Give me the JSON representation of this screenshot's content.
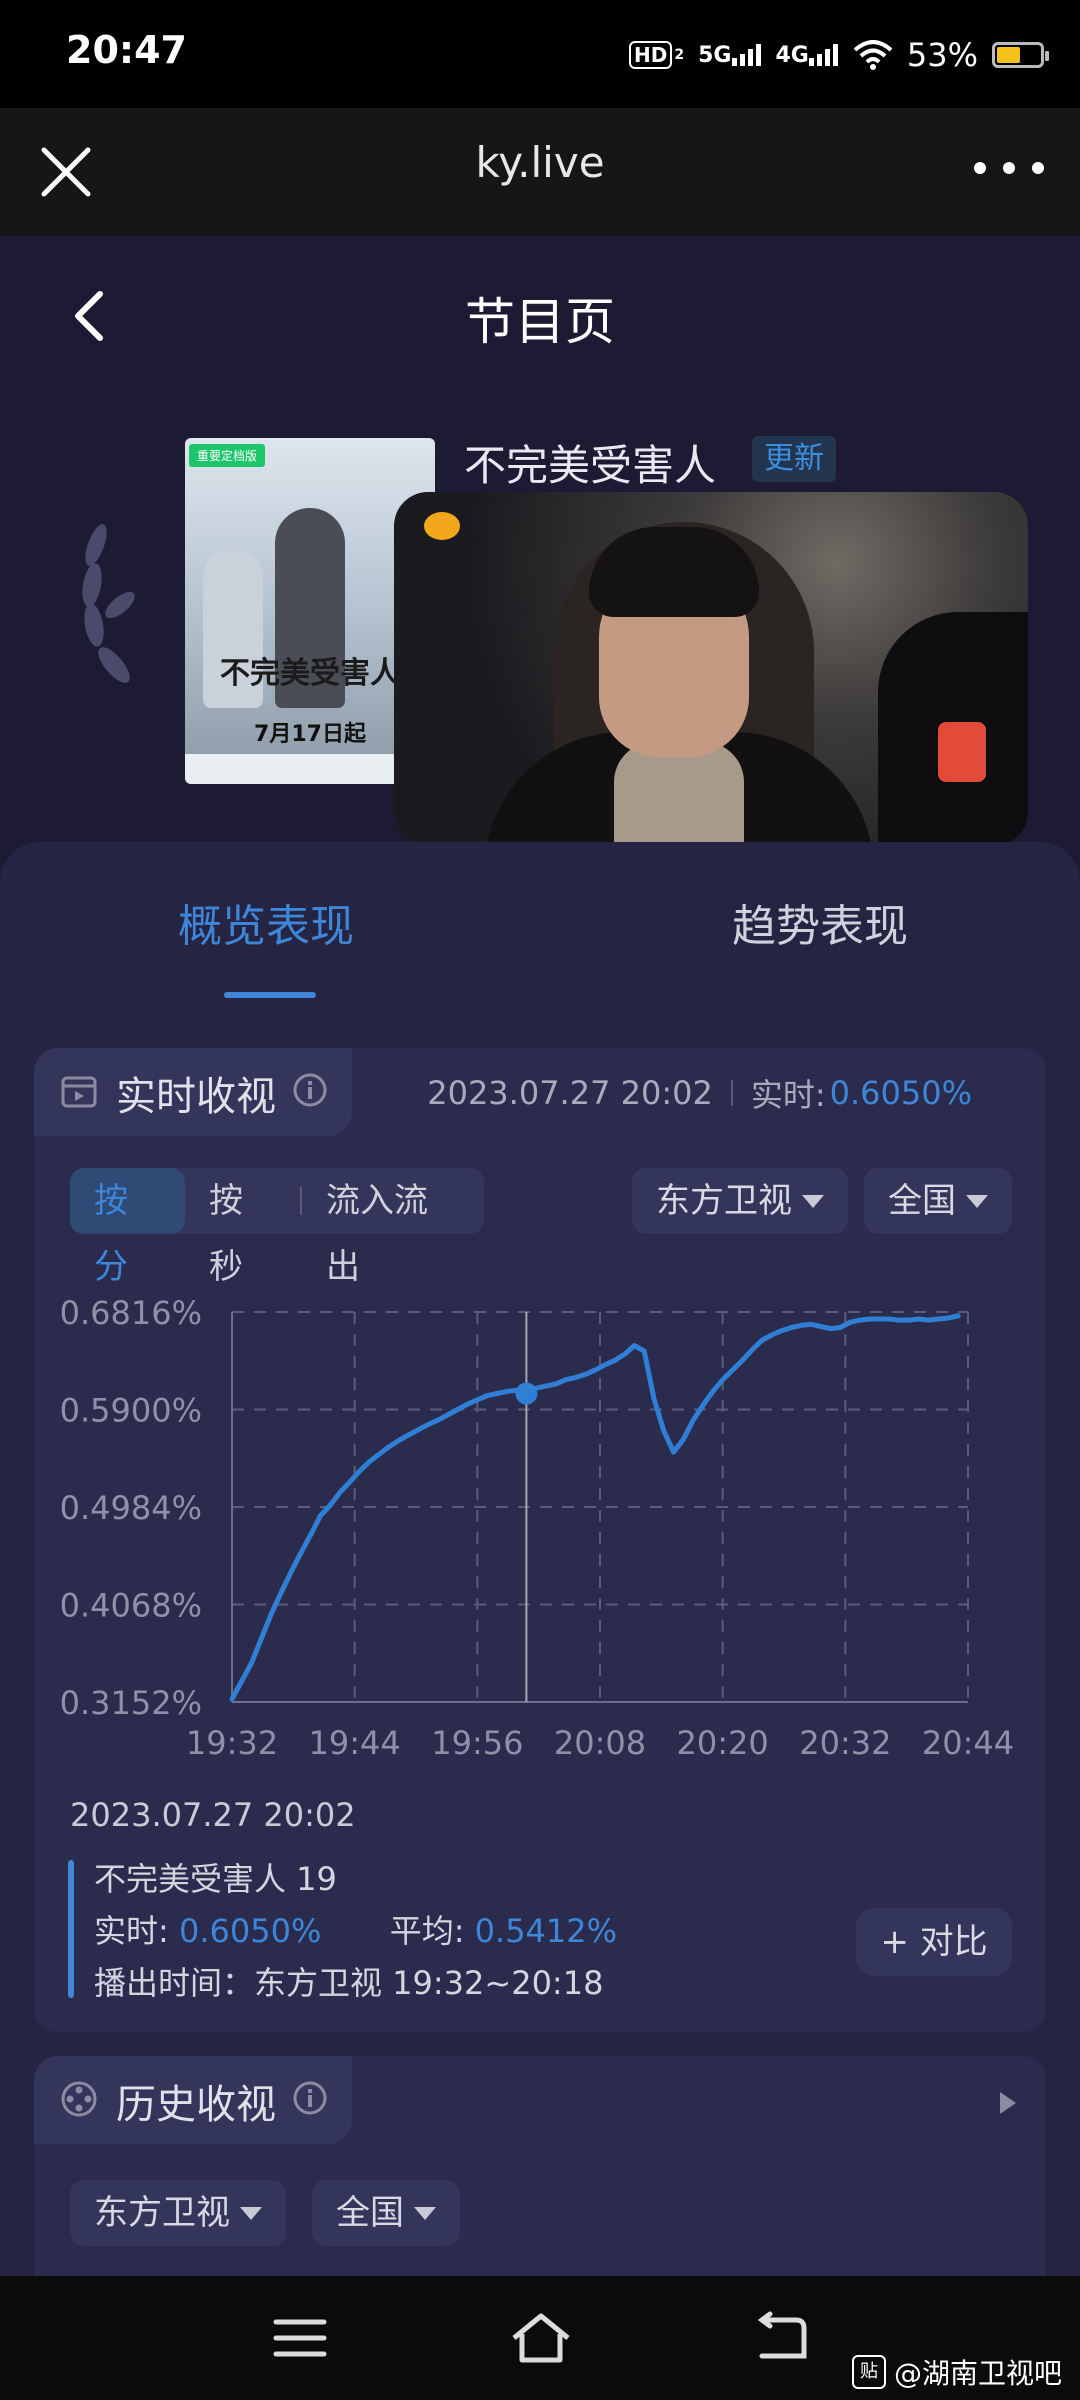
{
  "status_bar": {
    "time": "20:47",
    "hd": "HD",
    "hd_sub": "2",
    "net1": "5G",
    "net2": "4G",
    "battery": "53%",
    "battery_level": 0.53
  },
  "browser": {
    "title": "ky.live"
  },
  "page": {
    "title": "节目页"
  },
  "show": {
    "name": "不完美受害人",
    "tag": "更新",
    "poster": {
      "badge": "重要定档版",
      "title": "不完美受害人",
      "date": "7月17日起"
    }
  },
  "tabs": [
    {
      "label": "概览表现",
      "active": true
    },
    {
      "label": "趋势表现",
      "active": false
    }
  ],
  "realtime": {
    "title": "实时收视",
    "datetime": "2023.07.27 20:02",
    "realtime_label": "实时:",
    "realtime_value": "0.6050%",
    "modes": [
      "按分",
      "按秒",
      "流入流出"
    ],
    "channel": "东方卫视",
    "region": "全国",
    "detail": {
      "datetime": "2023.07.27 20:02",
      "episode": "不完美受害人 19",
      "rt_label": "实时:",
      "rt_value": "0.6050%",
      "avg_label": "平均:",
      "avg_value": "0.5412%",
      "airtime": "播出时间：东方卫视 19:32~20:18"
    },
    "compare_label": "+ 对比"
  },
  "history": {
    "title": "历史收视",
    "channel": "东方卫视",
    "region": "全国"
  },
  "watermark": {
    "icon": "贴",
    "text": "@湖南卫视吧"
  },
  "colors": {
    "accent": "#3d86d8",
    "panel": "#252543",
    "card": "#2b2c4d"
  },
  "chart_data": {
    "type": "line",
    "ylim": [
      0.3152,
      0.6816
    ],
    "yticks": [
      "0.6816%",
      "0.5900%",
      "0.4984%",
      "0.4068%",
      "0.3152%"
    ],
    "xticks": [
      "19:32",
      "19:44",
      "19:56",
      "20:08",
      "20:20",
      "20:32",
      "20:44"
    ],
    "xlim": [
      0,
      75
    ],
    "marker": {
      "x": 30,
      "y": 0.605
    },
    "series": [
      {
        "x": [
          0,
          1,
          2,
          3,
          4,
          5,
          6,
          7,
          8,
          9,
          10,
          11,
          12,
          13,
          14,
          15,
          16,
          17,
          18,
          19,
          20,
          21,
          22,
          23,
          24,
          25,
          26,
          27,
          28,
          29,
          30,
          31,
          32,
          33,
          34,
          35,
          36,
          37,
          38,
          39,
          40,
          41,
          42,
          43,
          44,
          45,
          46,
          47,
          48,
          49,
          50,
          51,
          52,
          53,
          54,
          55,
          56,
          57,
          58,
          59,
          60,
          61,
          62,
          63,
          64,
          65,
          66,
          67,
          68,
          69,
          70,
          71,
          72,
          73,
          74
        ],
        "values": [
          0.318,
          0.335,
          0.352,
          0.375,
          0.398,
          0.418,
          0.437,
          0.455,
          0.472,
          0.49,
          0.5,
          0.512,
          0.522,
          0.532,
          0.541,
          0.548,
          0.555,
          0.561,
          0.566,
          0.571,
          0.576,
          0.58,
          0.585,
          0.59,
          0.595,
          0.599,
          0.603,
          0.605,
          0.607,
          0.608,
          0.605,
          0.61,
          0.612,
          0.614,
          0.618,
          0.62,
          0.623,
          0.627,
          0.632,
          0.636,
          0.642,
          0.65,
          0.645,
          0.6,
          0.57,
          0.55,
          0.562,
          0.58,
          0.594,
          0.607,
          0.618,
          0.627,
          0.636,
          0.646,
          0.655,
          0.66,
          0.664,
          0.667,
          0.669,
          0.67,
          0.668,
          0.666,
          0.667,
          0.672,
          0.674,
          0.675,
          0.675,
          0.675,
          0.674,
          0.674,
          0.675,
          0.674,
          0.675,
          0.676,
          0.678
        ]
      }
    ]
  }
}
